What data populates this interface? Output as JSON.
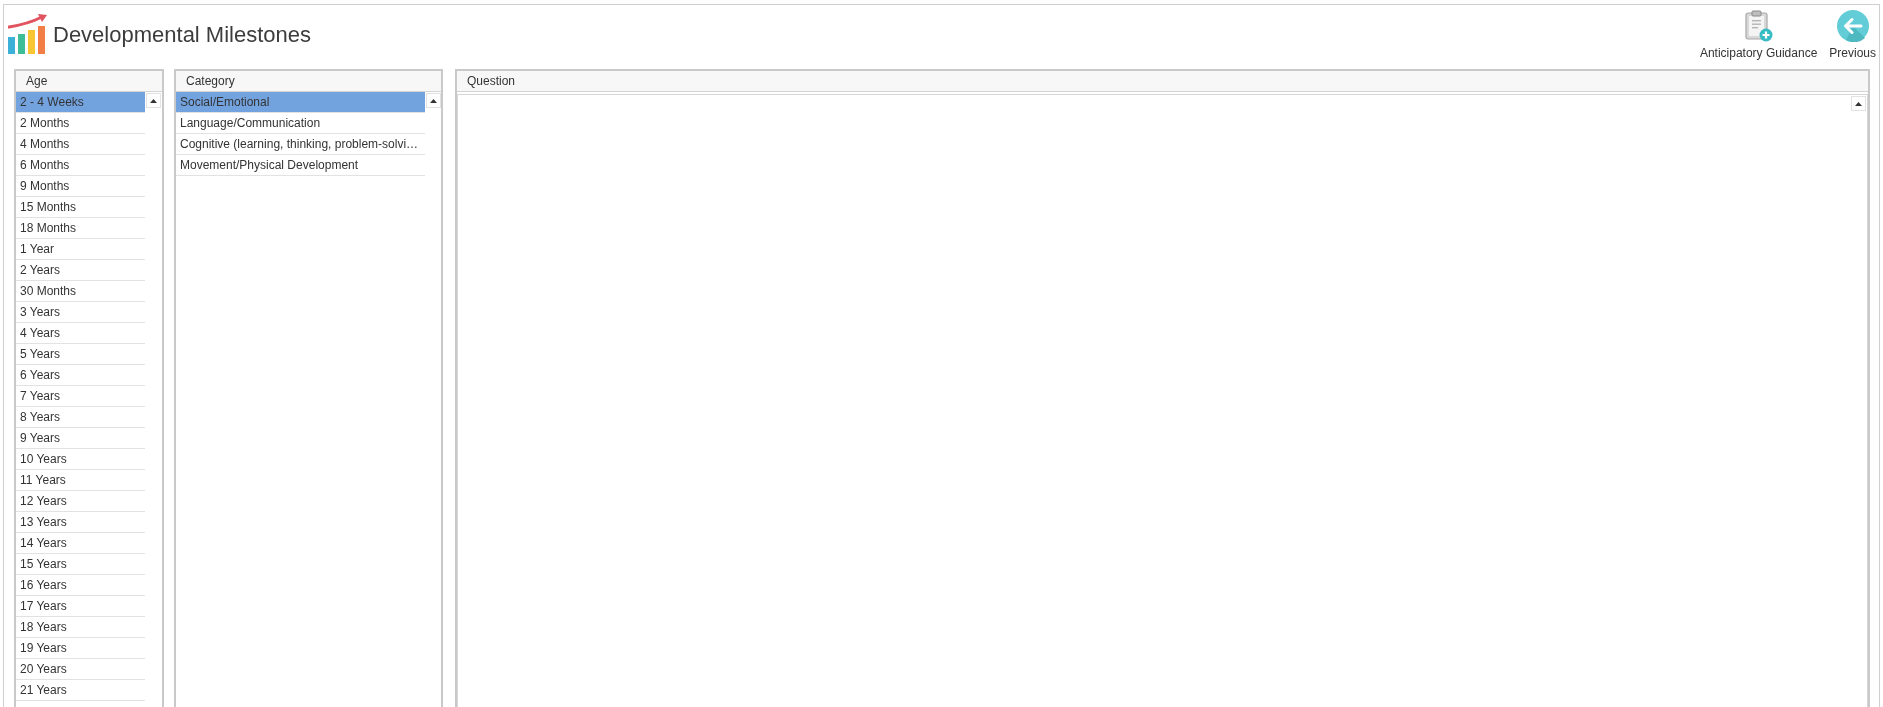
{
  "header": {
    "title": "Developmental Milestones"
  },
  "toolbar": [
    {
      "label": "Anticipatory Guidance",
      "kind": "clipboard"
    },
    {
      "label": "Previous",
      "kind": "back"
    }
  ],
  "age_list": {
    "heading": "Age",
    "items": [
      {
        "label": "2 - 4 Weeks",
        "selected": true
      },
      {
        "label": "2 Months",
        "selected": false
      },
      {
        "label": "4 Months",
        "selected": false
      },
      {
        "label": "6 Months",
        "selected": false
      },
      {
        "label": "9 Months",
        "selected": false
      },
      {
        "label": "15 Months",
        "selected": false
      },
      {
        "label": "18 Months",
        "selected": false
      },
      {
        "label": "1 Year",
        "selected": false
      },
      {
        "label": "2 Years",
        "selected": false
      },
      {
        "label": "30 Months",
        "selected": false
      },
      {
        "label": "3 Years",
        "selected": false
      },
      {
        "label": "4 Years",
        "selected": false
      },
      {
        "label": "5 Years",
        "selected": false
      },
      {
        "label": "6 Years",
        "selected": false
      },
      {
        "label": "7 Years",
        "selected": false
      },
      {
        "label": "8 Years",
        "selected": false
      },
      {
        "label": "9 Years",
        "selected": false
      },
      {
        "label": "10 Years",
        "selected": false
      },
      {
        "label": "11 Years",
        "selected": false
      },
      {
        "label": "12 Years",
        "selected": false
      },
      {
        "label": "13 Years",
        "selected": false
      },
      {
        "label": "14 Years",
        "selected": false
      },
      {
        "label": "15 Years",
        "selected": false
      },
      {
        "label": "16 Years",
        "selected": false
      },
      {
        "label": "17 Years",
        "selected": false
      },
      {
        "label": "18 Years",
        "selected": false
      },
      {
        "label": "19 Years",
        "selected": false
      },
      {
        "label": "20 Years",
        "selected": false
      },
      {
        "label": "21 Years",
        "selected": false
      }
    ]
  },
  "category_list": {
    "heading": "Category",
    "items": [
      {
        "label": "Social/Emotional",
        "selected": true
      },
      {
        "label": "Language/Communication",
        "selected": false
      },
      {
        "label": "Cognitive (learning, thinking, problem-solvi…",
        "selected": false
      },
      {
        "label": "Movement/Physical Development",
        "selected": false
      }
    ]
  },
  "question_panel": {
    "heading": "Question"
  }
}
